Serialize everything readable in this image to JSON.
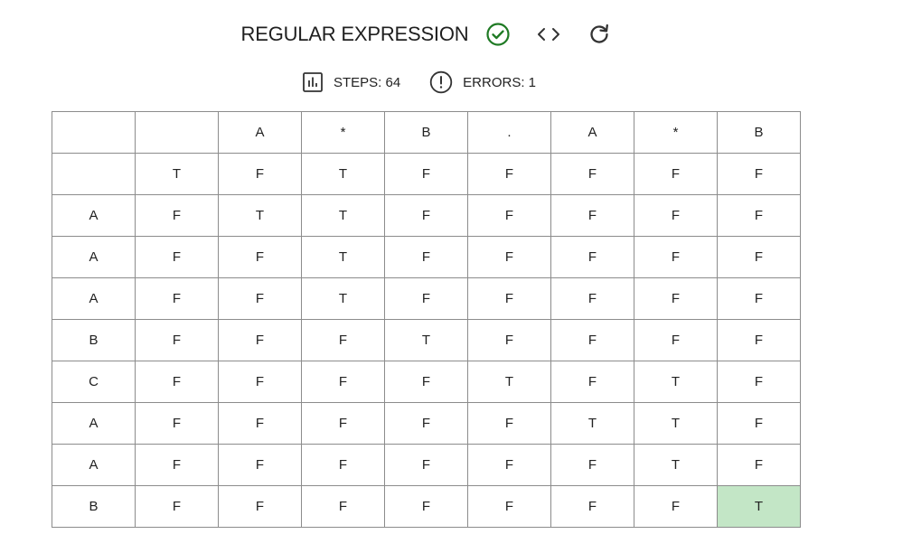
{
  "header": {
    "title": "REGULAR EXPRESSION",
    "status_icon": "check-circle-icon",
    "status_color": "#1f7a24",
    "code_icon": "code-icon",
    "reload_icon": "reload-icon"
  },
  "stats": {
    "steps_label": "STEPS: 64",
    "errors_label": "ERRORS: 1"
  },
  "table": {
    "highlight_color": "#c3e6c6",
    "highlighted_cell": "T",
    "rows": [
      [
        "",
        "",
        "A",
        "*",
        "B",
        ".",
        "A",
        "*",
        "B"
      ],
      [
        "",
        "T",
        "F",
        "T",
        "F",
        "F",
        "F",
        "F",
        "F"
      ],
      [
        "A",
        "F",
        "T",
        "T",
        "F",
        "F",
        "F",
        "F",
        "F"
      ],
      [
        "A",
        "F",
        "F",
        "T",
        "F",
        "F",
        "F",
        "F",
        "F"
      ],
      [
        "A",
        "F",
        "F",
        "T",
        "F",
        "F",
        "F",
        "F",
        "F"
      ],
      [
        "B",
        "F",
        "F",
        "F",
        "T",
        "F",
        "F",
        "F",
        "F"
      ],
      [
        "C",
        "F",
        "F",
        "F",
        "F",
        "T",
        "F",
        "T",
        "F"
      ],
      [
        "A",
        "F",
        "F",
        "F",
        "F",
        "F",
        "T",
        "T",
        "F"
      ],
      [
        "A",
        "F",
        "F",
        "F",
        "F",
        "F",
        "F",
        "T",
        "F"
      ],
      [
        "B",
        "F",
        "F",
        "F",
        "F",
        "F",
        "F",
        "F",
        "T"
      ]
    ]
  }
}
